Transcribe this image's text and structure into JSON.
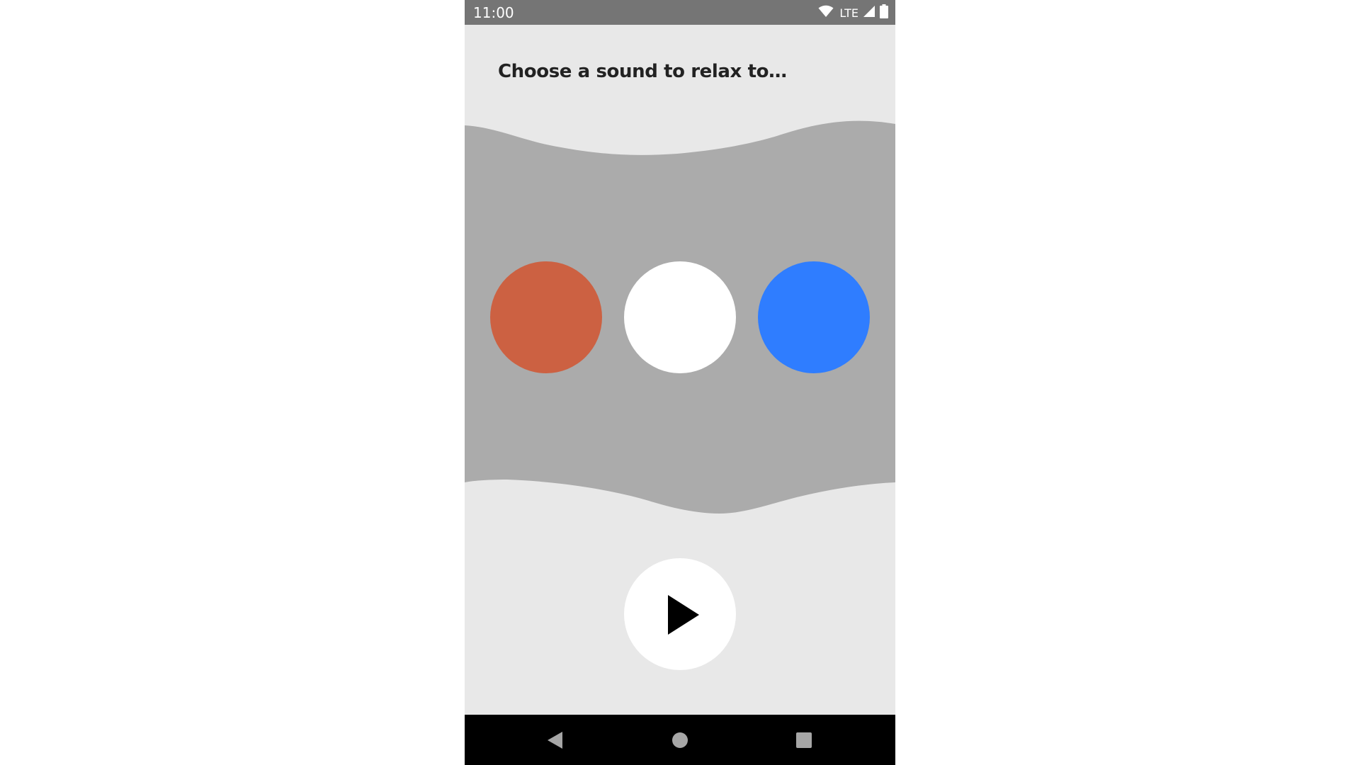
{
  "status_bar": {
    "time": "11:00",
    "network": "LTE",
    "icons": [
      "wifi-icon",
      "signal-icon",
      "battery-icon"
    ]
  },
  "prompt": "Choose a sound to relax to…",
  "colors": {
    "background": "#e8e8e8",
    "wave": "#ababab",
    "status_bar": "#757575",
    "nav_bar": "#000000"
  },
  "sounds": [
    {
      "color": "#cc6142"
    },
    {
      "color": "#ffffff"
    },
    {
      "color": "#2f7dff"
    }
  ],
  "play_button": {
    "icon": "play-icon"
  },
  "nav_bar": {
    "icons": [
      "back-icon",
      "home-icon",
      "recents-icon"
    ]
  }
}
